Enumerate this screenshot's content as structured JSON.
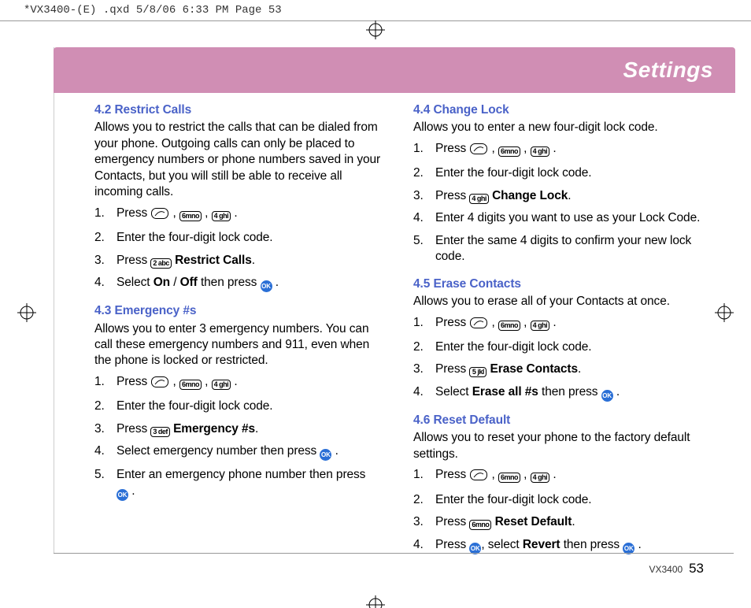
{
  "header_line": "*VX3400-(E) .qxd  5/8/06  6:33 PM  Page 53",
  "banner_title": "Settings",
  "footer": {
    "model": "VX3400",
    "page": "53"
  },
  "keys": {
    "menu": "",
    "2": "2 abc",
    "3": "3 def",
    "4": "4 ghi",
    "5": "5 jkl",
    "6": "6mno",
    "ok": "OK"
  },
  "left": {
    "s42": {
      "head": "4.2 Restrict Calls",
      "intro": "Allows you to restrict the calls that can be dialed from your phone. Outgoing calls can only be placed to emergency numbers or phone numbers saved in your Contacts, but you will still be able to receive all incoming calls.",
      "i1a": "Press ",
      "i2": "Enter the four-digit lock code.",
      "i3a": "Press ",
      "i3b": "Restrict Calls",
      "i4a": "Select ",
      "i4b": "On",
      "i4c": " / ",
      "i4d": "Off",
      "i4e": " then press "
    },
    "s43": {
      "head": "4.3 Emergency #s",
      "intro": "Allows you to enter 3 emergency numbers. You can call these emergency numbers and 911, even when the phone is locked or restricted.",
      "i1a": "Press ",
      "i2": "Enter the four-digit lock code.",
      "i3a": "Press ",
      "i3b": "Emergency #s",
      "i4a": "Select emergency number then press ",
      "i5a": "Enter an emergency phone number then press "
    }
  },
  "right": {
    "s44": {
      "head": "4.4 Change Lock",
      "intro": "Allows you to enter a new four-digit lock code.",
      "i1a": "Press ",
      "i2": "Enter the four-digit lock code.",
      "i3a": "Press ",
      "i3b": "Change Lock",
      "i4": "Enter 4 digits you want to use as your Lock Code.",
      "i5": "Enter the same 4 digits to confirm your new lock code."
    },
    "s45": {
      "head": "4.5 Erase Contacts",
      "intro": "Allows you to erase all of your Contacts at once.",
      "i1a": "Press ",
      "i2": "Enter the four-digit lock code.",
      "i3a": "Press ",
      "i3b": "Erase Contacts",
      "i4a": "Select ",
      "i4b": "Erase all #s",
      "i4c": " then press "
    },
    "s46": {
      "head": "4.6 Reset Default",
      "intro": "Allows you to reset your phone to the factory default settings.",
      "i1a": "Press  ",
      "i2": "Enter the four-digit lock code.",
      "i3a": "Press ",
      "i3b": "Reset Default",
      "i4a": "Press ",
      "i4b": ", select ",
      "i4c": "Revert",
      "i4d": " then press "
    }
  }
}
